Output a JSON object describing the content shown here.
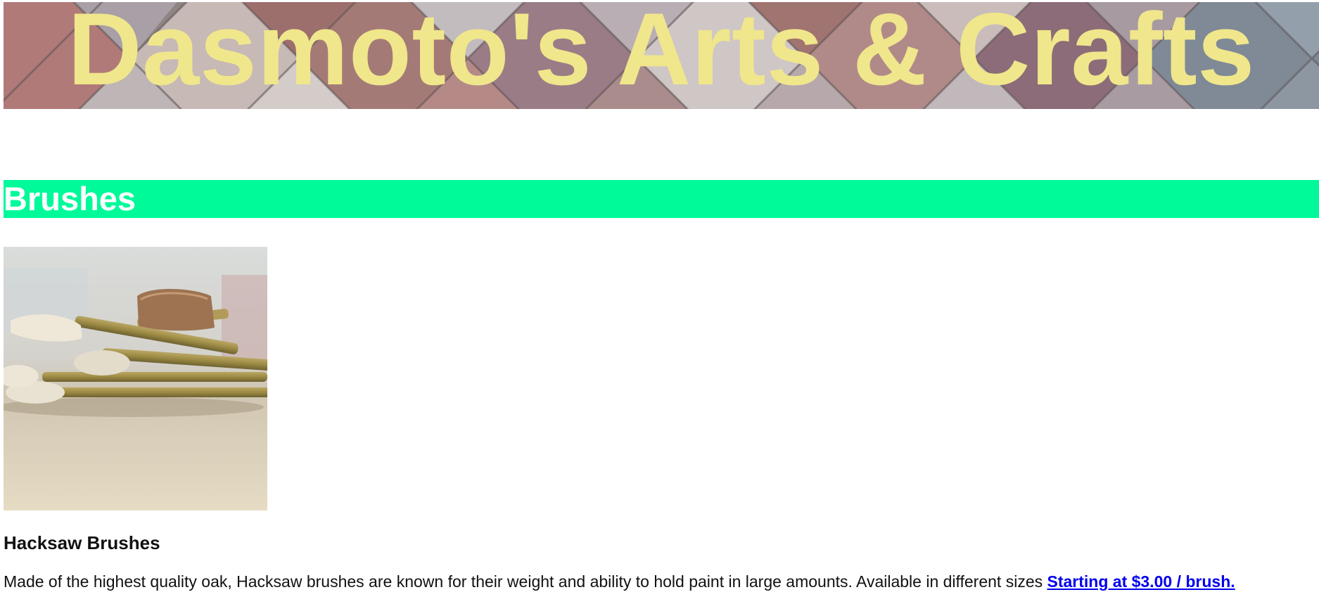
{
  "header": {
    "title": "Dasmoto's Arts & Crafts"
  },
  "sections": [
    {
      "heading": "Brushes",
      "product": {
        "name": "Hacksaw Brushes",
        "description": "Made of the highest quality oak, Hacksaw brushes are known for their weight and ability to hold paint in large amounts. Available in different sizes ",
        "price_link": "Starting at $3.00 / brush."
      }
    }
  ],
  "colors": {
    "title_text": "#f0e68c",
    "section_heading_bg": "#00fa9a",
    "section_heading_text": "#ffffff",
    "link": "#0000ee"
  },
  "icons": {
    "banner_background": "pattern-image",
    "product_photo": "brushes-photo"
  }
}
